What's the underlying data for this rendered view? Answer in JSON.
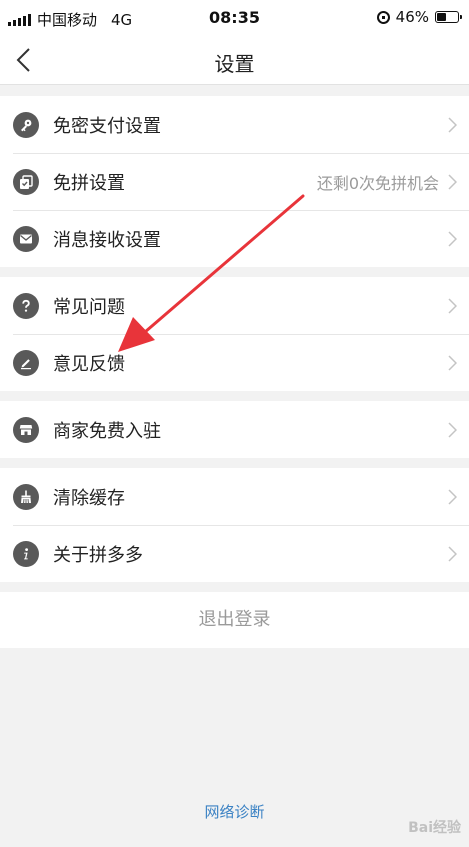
{
  "status_bar": {
    "carrier": "中国移动",
    "network": "4G",
    "time": "08:35",
    "battery_percent": "46%",
    "battery_level": 0.46
  },
  "nav": {
    "title": "设置"
  },
  "groups": [
    {
      "items": [
        {
          "label": "免密支付设置",
          "icon": "key-icon"
        },
        {
          "label": "免拼设置",
          "icon": "cards-icon",
          "hint": "还剩0次免拼机会"
        },
        {
          "label": "消息接收设置",
          "icon": "mail-icon"
        }
      ]
    },
    {
      "items": [
        {
          "label": "常见问题",
          "icon": "question-icon"
        },
        {
          "label": "意见反馈",
          "icon": "pencil-icon"
        }
      ]
    },
    {
      "items": [
        {
          "label": "商家免费入驻",
          "icon": "store-icon"
        }
      ]
    },
    {
      "items": [
        {
          "label": "清除缓存",
          "icon": "broom-icon"
        },
        {
          "label": "关于拼多多",
          "icon": "info-icon"
        }
      ]
    }
  ],
  "logout_label": "退出登录",
  "network_diagnosis_label": "网络诊断",
  "annotation": {
    "arrow_color": "#e8343a"
  },
  "watermark": {
    "text": "Bai经验"
  }
}
